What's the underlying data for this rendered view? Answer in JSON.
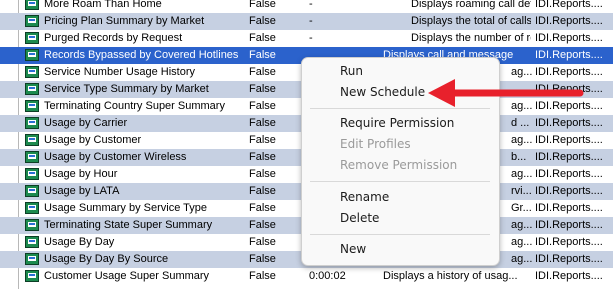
{
  "rows": [
    {
      "name": "More Roam Than Home",
      "flag": "False",
      "duration": "-",
      "description": "Displays roaming call detail...",
      "ref": "IDI.Reports...."
    },
    {
      "name": "Pricing Plan Summary by Market",
      "flag": "False",
      "duration": "-",
      "description": "Displays the total of calls, ...",
      "ref": "IDI.Reports...."
    },
    {
      "name": "Purged Records by Request",
      "flag": "False",
      "duration": "-",
      "description": "Displays the number of re...",
      "ref": "IDI.Reports...."
    },
    {
      "name": "Records Bypassed by Covered Hotlines",
      "flag": "False",
      "duration": "",
      "description": "",
      "ref": "IDI.Reports...."
    },
    {
      "name": "Service Number Usage History",
      "flag": "False",
      "duration": "",
      "description": "ag...",
      "ref": "IDI.Reports...."
    },
    {
      "name": "Service Type Summary by Market",
      "flag": "False",
      "duration": "",
      "description": "",
      "ref": "IDI.Reports...."
    },
    {
      "name": "Terminating Country Super Summary",
      "flag": "False",
      "duration": "",
      "description": "ag...",
      "ref": "IDI.Reports...."
    },
    {
      "name": "Usage by Carrier",
      "flag": "False",
      "duration": "",
      "description": "d ...",
      "ref": "IDI.Reports...."
    },
    {
      "name": "Usage by Customer",
      "flag": "False",
      "duration": "",
      "description": "ag...",
      "ref": "IDI.Reports...."
    },
    {
      "name": "Usage by Customer Wireless",
      "flag": "False",
      "duration": "",
      "description": "b...",
      "ref": "IDI.Reports...."
    },
    {
      "name": "Usage by Hour",
      "flag": "False",
      "duration": "",
      "description": "ag...",
      "ref": "IDI.Reports...."
    },
    {
      "name": "Usage by LATA",
      "flag": "False",
      "duration": "",
      "description": "rvi...",
      "ref": "IDI.Reports...."
    },
    {
      "name": "Usage Summary by Service Type",
      "flag": "False",
      "duration": "",
      "description": "Gr...",
      "ref": "IDI.Reports...."
    },
    {
      "name": "Terminating State Super Summary",
      "flag": "False",
      "duration": "",
      "description": "ag...",
      "ref": "IDI.Reports...."
    },
    {
      "name": "Usage By Day",
      "flag": "False",
      "duration": "",
      "description": "ag...",
      "ref": "IDI.Reports...."
    },
    {
      "name": "Usage By Day By Source",
      "flag": "False",
      "duration": "",
      "description": "ag...",
      "ref": "IDI.Reports...."
    },
    {
      "name": "Customer Usage Super Summary",
      "flag": "False",
      "duration": "0:00:02",
      "description": "Displays a history of usag...",
      "ref": "IDI.Reports...."
    }
  ],
  "selected_row_partial_description": "Displays call and message",
  "menu": {
    "run": "Run",
    "new_schedule": "New Schedule",
    "require_permission": "Require Permission",
    "edit_profiles": "Edit Profiles",
    "remove_permission": "Remove Permission",
    "rename": "Rename",
    "delete": "Delete",
    "new": "New"
  },
  "colors": {
    "selected_row": "#2b62cc",
    "alt_row": "#c6d0e2",
    "annotation_arrow": "#e8212c"
  }
}
